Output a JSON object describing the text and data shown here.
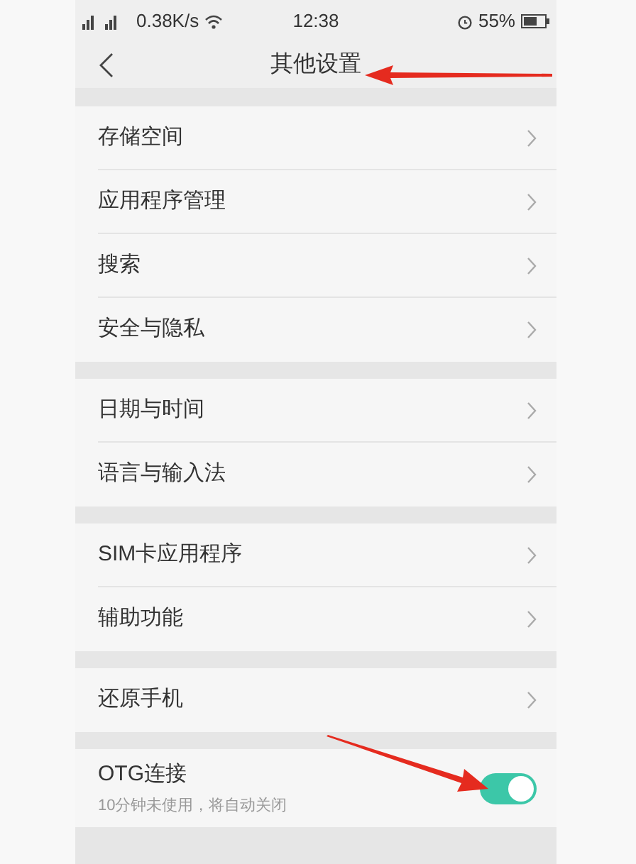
{
  "status_bar": {
    "network_speed": "0.38K/s",
    "time": "12:38",
    "battery_percent": "55%"
  },
  "header": {
    "title": "其他设置"
  },
  "sections": [
    {
      "items": [
        {
          "kind": "link",
          "label": "存储空间"
        },
        {
          "kind": "link",
          "label": "应用程序管理"
        },
        {
          "kind": "link",
          "label": "搜索"
        },
        {
          "kind": "link",
          "label": "安全与隐私"
        }
      ]
    },
    {
      "items": [
        {
          "kind": "link",
          "label": "日期与时间"
        },
        {
          "kind": "link",
          "label": "语言与输入法"
        }
      ]
    },
    {
      "items": [
        {
          "kind": "link",
          "label": "SIM卡应用程序"
        },
        {
          "kind": "link",
          "label": "辅助功能"
        }
      ]
    },
    {
      "items": [
        {
          "kind": "link",
          "label": "还原手机"
        }
      ]
    },
    {
      "items": [
        {
          "kind": "toggle",
          "label": "OTG连接",
          "subtitle": "10分钟未使用，将自动关闭",
          "on": true
        }
      ]
    }
  ]
}
